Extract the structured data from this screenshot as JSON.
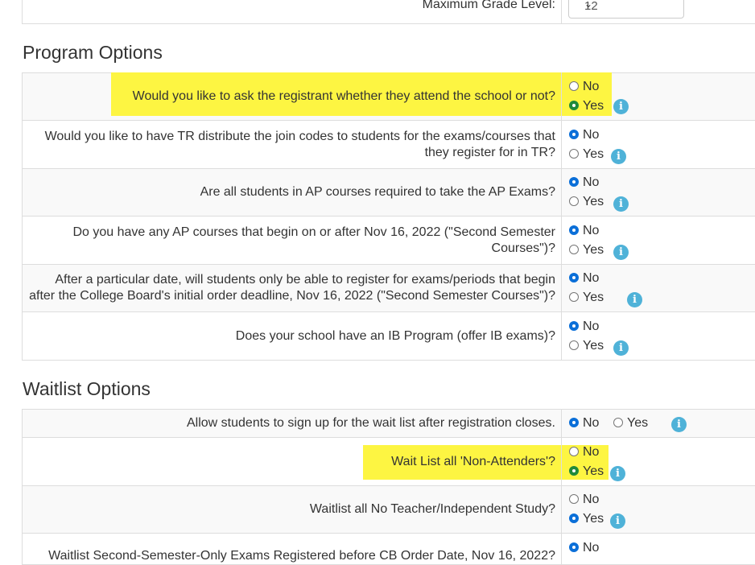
{
  "top": {
    "label": "Maximum Grade Level:",
    "select_value": "12"
  },
  "program": {
    "title": "Program Options",
    "questions": [
      {
        "l1": "Would you like to ask the registrant whether they attend the school or not?",
        "l2": "",
        "no": "No",
        "yes": "Yes",
        "selected": "Yes",
        "highlighted": true
      },
      {
        "l1": "Would you like to have TR distribute the join codes to students for the exams/courses that",
        "l2": "they register for in TR?",
        "no": "No",
        "yes": "Yes",
        "selected": "No"
      },
      {
        "l1": "Are all students in AP courses required to take the AP Exams?",
        "l2": "",
        "no": "No",
        "yes": "Yes",
        "selected": "No"
      },
      {
        "l1": "Do you have any AP courses that begin on or after Nov 16, 2022 (\"Second Semester",
        "l2": "Courses\")?",
        "no": "No",
        "yes": "Yes",
        "selected": "No"
      },
      {
        "l1": "After a particular date, will students only be able to register for exams/periods that begin",
        "l2": "after the College Board's initial order deadline, Nov 16, 2022 (\"Second Semester Courses\")?",
        "no": "No",
        "yes": "Yes",
        "selected": "No"
      },
      {
        "l1": "Does your school have an IB Program (offer IB exams)?",
        "l2": "",
        "no": "No",
        "yes": "Yes",
        "selected": "No"
      }
    ]
  },
  "waitlist": {
    "title": "Waitlist Options",
    "questions": [
      {
        "l1": "Allow students to sign up for the wait list after registration closes.",
        "no": "No",
        "yes": "Yes",
        "selected": "No"
      },
      {
        "l1": "Wait List all 'Non-Attenders'?",
        "no": "No",
        "yes": "Yes",
        "selected": "Yes",
        "highlighted": true
      },
      {
        "l1": "Waitlist all No Teacher/Independent Study?",
        "no": "No",
        "yes": "Yes",
        "selected": "Yes"
      },
      {
        "l1": "Waitlist Second-Semester-Only Exams Registered before CB Order Date, Nov 16, 2022?",
        "no": "No",
        "selected": "No"
      }
    ]
  },
  "info_glyph": "i",
  "colors": {
    "highlight": "#fdf542",
    "radio_selected": "#0b6fd8",
    "radio_selected_highlight": "#1f8a3a",
    "info": "#4fb2d8"
  }
}
